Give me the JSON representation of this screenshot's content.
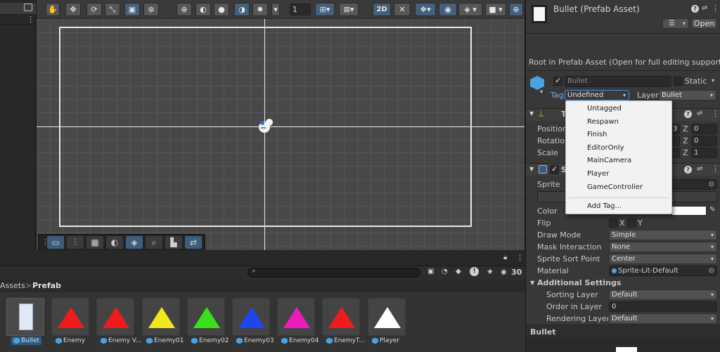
{
  "toolbar": {
    "grid_step": "1",
    "mode_2d": "2D"
  },
  "project": {
    "count": "30",
    "breadcrumb_root": "Assets",
    "breadcrumb_sep": ">",
    "breadcrumb_current": "Prefab",
    "assets": [
      {
        "label": "Bullet",
        "color": "#dfe8f5",
        "shape": "rect",
        "selected": true
      },
      {
        "label": "Enemy",
        "color": "#ee1c1c",
        "shape": "tri"
      },
      {
        "label": "Enemy V...",
        "color": "#ee1c1c",
        "shape": "tri"
      },
      {
        "label": "Enemy01",
        "color": "#f2e61c",
        "shape": "tri"
      },
      {
        "label": "Enemy02",
        "color": "#37e11c",
        "shape": "tri"
      },
      {
        "label": "Enemy03",
        "color": "#1f46ee",
        "shape": "tri"
      },
      {
        "label": "Enemy04",
        "color": "#ec1cbb",
        "shape": "tri"
      },
      {
        "label": "EnemyT...",
        "color": "#ee1c1c",
        "shape": "tri"
      },
      {
        "label": "Player",
        "color": "#ffffff",
        "shape": "tri"
      }
    ]
  },
  "inspector": {
    "title": "Bullet (Prefab Asset)",
    "open_button": "Open",
    "root_notice": "Root in Prefab Asset (Open for full editing support)",
    "object_name": "Bullet",
    "static_label": "Static",
    "tag_label": "Tag",
    "tag_value": "Undefined",
    "layer_label": "Layer",
    "layer_value": "Bullet",
    "transform": {
      "title_initial": "T",
      "position_label": "Position",
      "rotation_label": "Rotation",
      "scale_label": "Scale",
      "pos_x_tail": "3",
      "z_label": "Z",
      "pos_z": "0",
      "rot_z": "0",
      "scale_z": "1"
    },
    "sprite_renderer": {
      "title_initial": "S",
      "sprite_label": "Sprite",
      "color_label": "Color",
      "flip_label": "Flip",
      "flip_x": "X",
      "flip_y": "Y",
      "draw_mode_label": "Draw Mode",
      "draw_mode": "Simple",
      "mask_label": "Mask Interaction",
      "mask_value": "None",
      "sort_point_label": "Sprite Sort Point",
      "sort_point": "Center",
      "material_label": "Material",
      "material_value": "Sprite-Lit-Default",
      "additional_label": "Additional Settings",
      "sorting_layer_label": "Sorting Layer",
      "sorting_layer": "Default",
      "order_label": "Order in Layer",
      "order_value": "0",
      "rendering_label": "Rendering Layer M",
      "rendering_value": "Default"
    },
    "preview_label": "Bullet"
  },
  "tag_menu": {
    "items": [
      "Untagged",
      "Respawn",
      "Finish",
      "EditorOnly",
      "MainCamera",
      "Player",
      "GameController"
    ],
    "add_tag": "Add Tag..."
  },
  "colors": {
    "accent": "#46607c",
    "selection": "#2c5d87",
    "tag_highlight": "#4a8fd8"
  }
}
